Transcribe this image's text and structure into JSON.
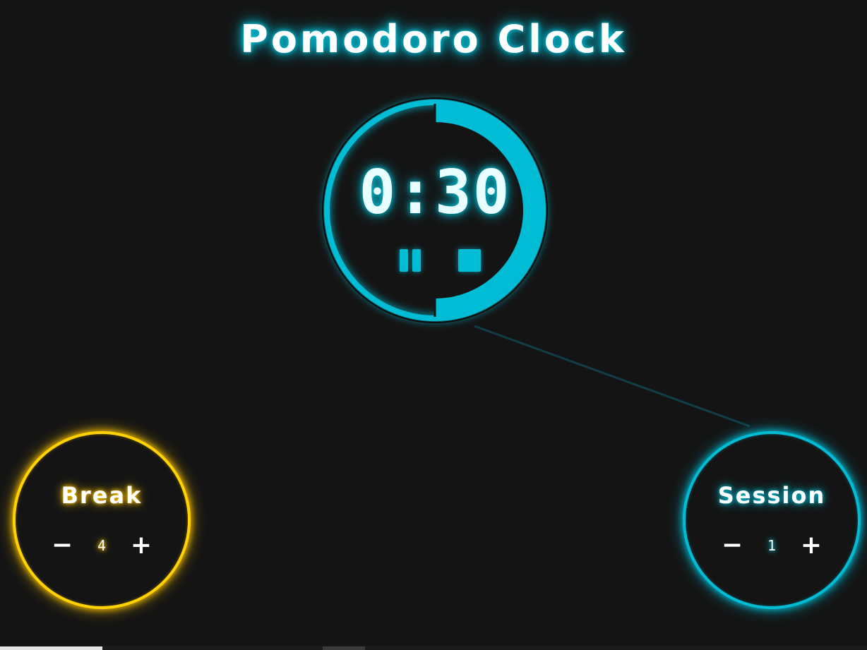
{
  "app": {
    "title": "Pomodoro Clock"
  },
  "timer": {
    "display": "0:30",
    "progress_remaining": 0.5,
    "mode": "session",
    "pause_icon": "pause-icon",
    "stop_icon": "stop-icon"
  },
  "break_dial": {
    "label": "Break",
    "value": "4",
    "minus_label": "−",
    "plus_label": "+"
  },
  "session_dial": {
    "label": "Session",
    "value": "1",
    "minus_label": "−",
    "plus_label": "+"
  },
  "colors": {
    "background": "#141414",
    "session_accent": "#00bcd4",
    "break_accent": "#ffd200",
    "text": "#ffffff"
  }
}
